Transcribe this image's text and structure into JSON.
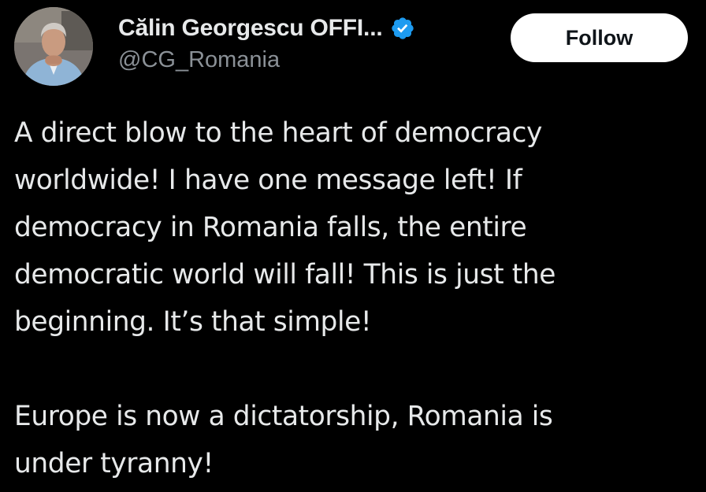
{
  "author": {
    "display_name": "Călin Georgescu OFFI...",
    "handle": "@CG_Romania",
    "verified": true,
    "verified_color": "#1d9bf0"
  },
  "actions": {
    "follow_label": "Follow"
  },
  "post": {
    "paragraph_1": [
      "A direct blow to the heart of democracy",
      "worldwide! I have one message left! If",
      "democracy in Romania falls, the entire",
      "democratic world will fall! This is just the",
      "beginning. It’s that simple!"
    ],
    "paragraph_2": [
      "Europe is now a dictatorship, Romania is",
      "under tyranny!"
    ]
  },
  "icons": {
    "avatar": "profile-photo",
    "verified": "verified-badge-icon"
  },
  "colors": {
    "background": "#000000",
    "text": "#e7e9ea",
    "handle": "#8b9197",
    "button_bg": "#ffffff",
    "button_text": "#0f1419"
  }
}
